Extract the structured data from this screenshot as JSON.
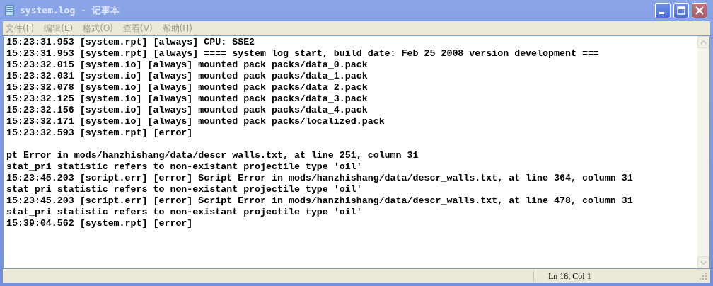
{
  "window": {
    "title": "system.log - 记事本"
  },
  "menu": [
    "文件(F)",
    "编辑(E)",
    "格式(O)",
    "查看(V)",
    "帮助(H)"
  ],
  "lines": [
    {
      "kind": "text",
      "text": "15:23:31.953 [system.rpt] [always] CPU: SSE2"
    },
    {
      "kind": "text",
      "text": "15:23:31.953 [system.rpt] [always] ==== system log start, build date: Feb 25 2008 version development ==="
    },
    {
      "kind": "text",
      "text": "15:23:32.015 [system.io] [always] mounted pack packs/data_0.pack"
    },
    {
      "kind": "text",
      "text": "15:23:32.031 [system.io] [always] mounted pack packs/data_1.pack"
    },
    {
      "kind": "text",
      "text": "15:23:32.078 [system.io] [always] mounted pack packs/data_2.pack"
    },
    {
      "kind": "text",
      "text": "15:23:32.125 [system.io] [always] mounted pack packs/data_3.pack"
    },
    {
      "kind": "text",
      "text": "15:23:32.156 [system.io] [always] mounted pack packs/data_4.pack"
    },
    {
      "kind": "text",
      "text": "15:23:32.171 [system.io] [always] mounted pack packs/localized.pack"
    },
    {
      "kind": "text",
      "text": "15:23:32.593 [system.rpt] [error]"
    },
    {
      "kind": "blank"
    },
    {
      "kind": "text",
      "text": "pt Error in mods/hanzhishang/data/descr_walls.txt, at line 251, column 31"
    },
    {
      "kind": "text",
      "text": "stat_pri statistic refers to non-existant projectile type 'oil'"
    },
    {
      "kind": "text",
      "text": "15:23:45.203 [script.err] [error] Script Error in mods/hanzhishang/data/descr_walls.txt, at line 364, column 31"
    },
    {
      "kind": "text",
      "text": "stat_pri statistic refers to non-existant projectile type 'oil'"
    },
    {
      "kind": "text",
      "text": "15:23:45.203 [script.err] [error] Script Error in mods/hanzhishang/data/descr_walls.txt, at line 478, column 31"
    },
    {
      "kind": "text",
      "text": "stat_pri statistic refers to non-existant projectile type 'oil'"
    },
    {
      "kind": "text",
      "text": "15:39:04.562 [system.rpt] [error]"
    }
  ],
  "status_bar": {
    "position": "Ln 18, Col 1"
  }
}
